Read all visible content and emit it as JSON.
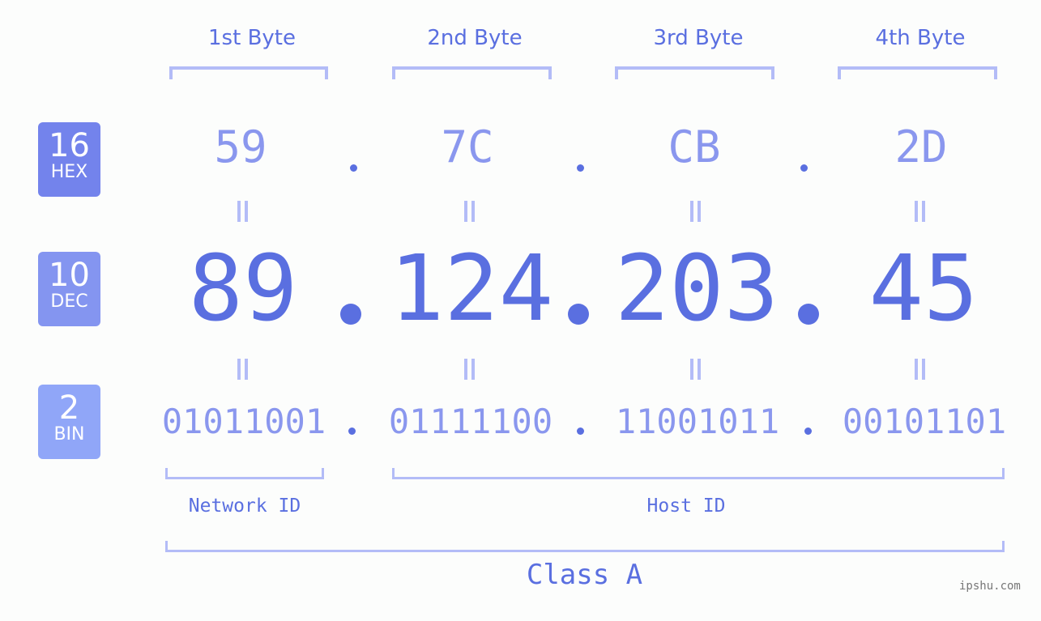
{
  "bytes": [
    {
      "header": "1st Byte",
      "hex": "59",
      "dec": "89",
      "bin": "01011001"
    },
    {
      "header": "2nd Byte",
      "hex": "7C",
      "dec": "124",
      "bin": "01111100"
    },
    {
      "header": "3rd Byte",
      "hex": "CB",
      "dec": "203",
      "bin": "11001011"
    },
    {
      "header": "4th Byte",
      "hex": "2D",
      "dec": "45",
      "bin": "00101101"
    }
  ],
  "bases": {
    "hex": {
      "num": "16",
      "label": "HEX",
      "color": "#7383ec"
    },
    "dec": {
      "num": "10",
      "label": "DEC",
      "color": "#8495f0"
    },
    "bin": {
      "num": "2",
      "label": "BIN",
      "color": "#90a6f8"
    }
  },
  "segments": {
    "network": "Network ID",
    "host": "Host ID"
  },
  "ip_class": "Class A",
  "watermark": "ipshu.com",
  "colors": {
    "primary": "#5a6fe0",
    "light": "#8a97ee",
    "bracket": "#b3bcf7"
  }
}
